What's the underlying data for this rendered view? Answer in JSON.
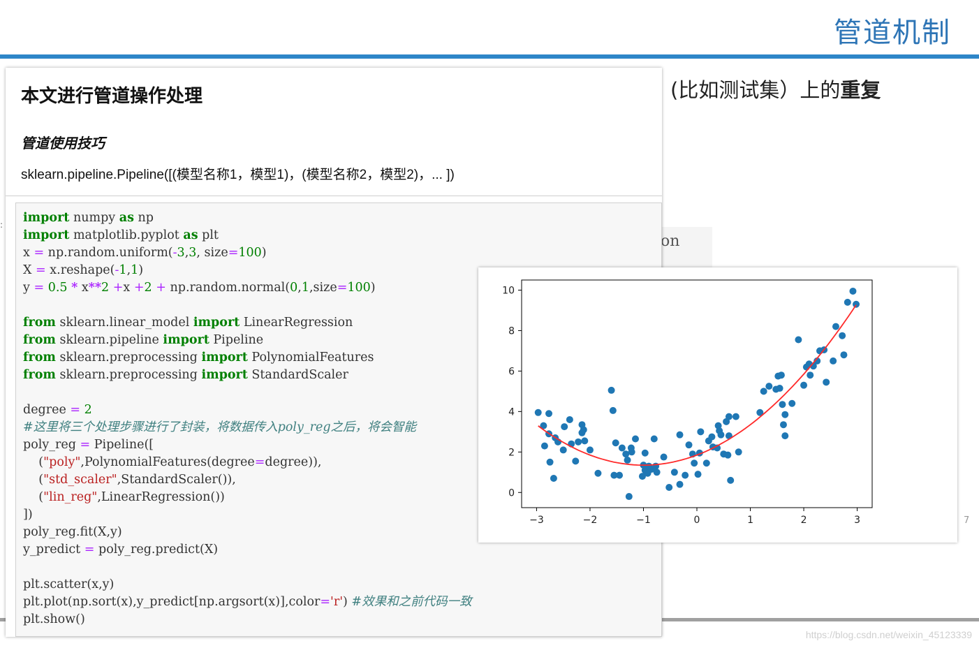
{
  "slide": {
    "title": "管道机制",
    "bg_text_normal": "(比如测试集）上的",
    "bg_text_bold": "重复",
    "bg_fragment": "on",
    "page_number": "7",
    "watermark": "https://blog.csdn.net/weixin_45123339",
    "left_marker": ":"
  },
  "notebook": {
    "heading": "本文进行管道操作处理",
    "subheading": "管道使用技巧",
    "signature": "sklearn.pipeline.Pipeline([(模型名称1，模型1)，(模型名称2，模型2)，... ])",
    "code_lines": [
      "import numpy as np",
      "import matplotlib.pyplot as plt",
      "x = np.random.uniform(-3,3, size=100)",
      "X = x.reshape(-1,1)",
      "y = 0.5 * x**2 +x +2 + np.random.normal(0,1,size=100)",
      "",
      "from sklearn.linear_model import LinearRegression",
      "from sklearn.pipeline import Pipeline",
      "from sklearn.preprocessing import PolynomialFeatures",
      "from sklearn.preprocessing import StandardScaler",
      "",
      "degree = 2",
      "#这里将三个处理步骤进行了封装，将数据传入poly_reg之后，将会智能",
      "poly_reg = Pipeline([",
      "    (\"poly\",PolynomialFeatures(degree=degree)),",
      "    (\"std_scaler\",StandardScaler()),",
      "    (\"lin_reg\",LinearRegression())",
      "])",
      "poly_reg.fit(X,y)",
      "y_predict = poly_reg.predict(X)",
      "",
      "plt.scatter(x,y)",
      "plt.plot(np.sort(x),y_predict[np.argsort(x)],color='r') #效果和之前代码一致",
      "plt.show()"
    ]
  },
  "chart_data": {
    "type": "scatter",
    "title": "",
    "xlabel": "",
    "ylabel": "",
    "xlim": [
      -3.28,
      3.28
    ],
    "ylim": [
      -0.75,
      10.5
    ],
    "xticks": [
      -3,
      -2,
      -1,
      0,
      1,
      2,
      3
    ],
    "xtick_labels": [
      "−3",
      "−2",
      "−1",
      "0",
      "1",
      "2",
      "3"
    ],
    "yticks": [
      0,
      2,
      4,
      6,
      8,
      10
    ],
    "ytick_labels": [
      "0",
      "2",
      "4",
      "6",
      "8",
      "10"
    ],
    "grid": false,
    "legend": "none",
    "scatter_color": "#1f77b4",
    "line_color": "#ff2a2a",
    "points": [
      [
        -2.97,
        3.95
      ],
      [
        -2.87,
        3.3
      ],
      [
        -2.85,
        2.3
      ],
      [
        -2.77,
        3.9
      ],
      [
        -2.77,
        2.9
      ],
      [
        -2.75,
        1.5
      ],
      [
        -2.68,
        0.7
      ],
      [
        -2.65,
        2.7
      ],
      [
        -2.6,
        2.5
      ],
      [
        -2.5,
        2.1
      ],
      [
        -2.48,
        3.25
      ],
      [
        -2.38,
        3.6
      ],
      [
        -2.35,
        2.4
      ],
      [
        -2.27,
        1.55
      ],
      [
        -2.22,
        2.5
      ],
      [
        -2.15,
        3.35
      ],
      [
        -2.15,
        2.95
      ],
      [
        -2.12,
        3.1
      ],
      [
        -2.1,
        2.55
      ],
      [
        -2.0,
        2.1
      ],
      [
        -1.85,
        0.95
      ],
      [
        -1.6,
        5.05
      ],
      [
        -1.57,
        4.05
      ],
      [
        -1.55,
        0.85
      ],
      [
        -1.52,
        2.45
      ],
      [
        -1.45,
        0.85
      ],
      [
        -1.4,
        2.2
      ],
      [
        -1.33,
        1.9
      ],
      [
        -1.3,
        1.6
      ],
      [
        -1.27,
        -0.2
      ],
      [
        -1.23,
        2.2
      ],
      [
        -1.22,
        2.0
      ],
      [
        -1.15,
        2.65
      ],
      [
        -1.02,
        0.8
      ],
      [
        -1.0,
        1.35
      ],
      [
        -0.97,
        1.95
      ],
      [
        -0.97,
        1.1
      ],
      [
        -0.92,
        0.95
      ],
      [
        -0.9,
        1.3
      ],
      [
        -0.85,
        1.15
      ],
      [
        -0.8,
        2.65
      ],
      [
        -0.77,
        1.3
      ],
      [
        -0.75,
        1.0
      ],
      [
        -0.62,
        1.75
      ],
      [
        -0.52,
        0.25
      ],
      [
        -0.42,
        1.0
      ],
      [
        -0.32,
        0.4
      ],
      [
        -0.32,
        2.85
      ],
      [
        -0.22,
        0.85
      ],
      [
        -0.15,
        2.35
      ],
      [
        -0.08,
        1.9
      ],
      [
        -0.05,
        1.45
      ],
      [
        0.02,
        0.9
      ],
      [
        0.05,
        1.95
      ],
      [
        0.07,
        3.0
      ],
      [
        0.18,
        1.45
      ],
      [
        0.22,
        2.55
      ],
      [
        0.28,
        2.75
      ],
      [
        0.3,
        2.25
      ],
      [
        0.38,
        2.2
      ],
      [
        0.4,
        3.3
      ],
      [
        0.42,
        3.05
      ],
      [
        0.45,
        2.85
      ],
      [
        0.5,
        1.9
      ],
      [
        0.55,
        3.5
      ],
      [
        0.58,
        1.85
      ],
      [
        0.6,
        2.8
      ],
      [
        0.6,
        3.75
      ],
      [
        0.63,
        0.6
      ],
      [
        0.73,
        3.75
      ],
      [
        0.78,
        2.0
      ],
      [
        1.18,
        3.95
      ],
      [
        1.25,
        5.0
      ],
      [
        1.35,
        5.25
      ],
      [
        1.48,
        5.1
      ],
      [
        1.52,
        5.75
      ],
      [
        1.55,
        5.15
      ],
      [
        1.58,
        5.8
      ],
      [
        1.6,
        4.35
      ],
      [
        1.62,
        3.35
      ],
      [
        1.65,
        3.85
      ],
      [
        1.65,
        2.8
      ],
      [
        1.78,
        4.4
      ],
      [
        1.9,
        7.55
      ],
      [
        2.0,
        5.3
      ],
      [
        2.05,
        6.2
      ],
      [
        2.1,
        6.35
      ],
      [
        2.12,
        5.8
      ],
      [
        2.18,
        6.25
      ],
      [
        2.25,
        6.5
      ],
      [
        2.3,
        7.0
      ],
      [
        2.38,
        7.05
      ],
      [
        2.42,
        5.45
      ],
      [
        2.55,
        6.5
      ],
      [
        2.6,
        8.2
      ],
      [
        2.72,
        7.75
      ],
      [
        2.75,
        6.8
      ],
      [
        2.82,
        9.4
      ],
      [
        2.92,
        9.95
      ],
      [
        2.98,
        9.3
      ]
    ],
    "fit_curve": {
      "a": 0.5,
      "b": 1.0,
      "c": 1.85,
      "x_start": -2.97,
      "x_end": 2.98
    }
  }
}
